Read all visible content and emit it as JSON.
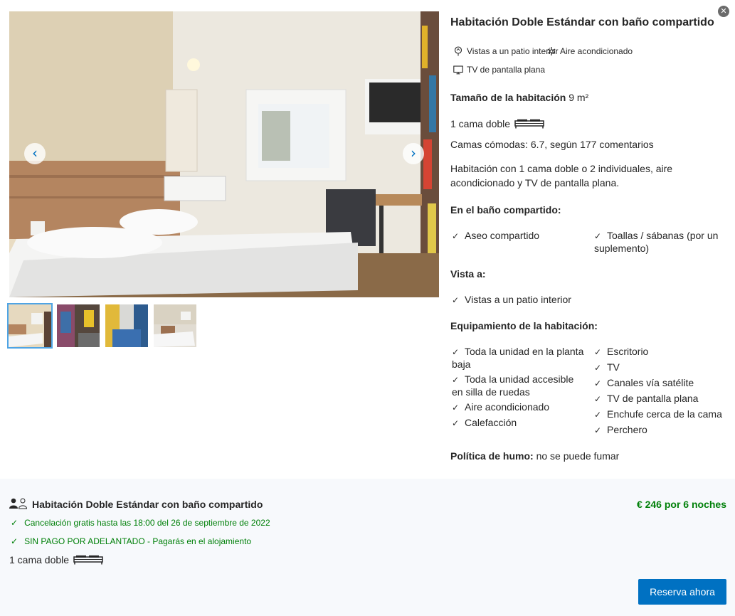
{
  "dialog": {
    "close_icon": "close-icon"
  },
  "gallery": {
    "prev_icon": "chevron-left-icon",
    "next_icon": "chevron-right-icon",
    "thumb_count": 4,
    "selected_thumb": 1
  },
  "room": {
    "title": "Habitación Doble Estándar con baño compartido",
    "facilities": [
      {
        "icon": "courtyard-icon",
        "label": "Vistas a un patio interior"
      },
      {
        "icon": "snowflake-icon",
        "label": "Aire acondicionado"
      },
      {
        "icon": "tv-icon",
        "label": "TV de pantalla plana"
      }
    ],
    "size_label": "Tamaño de la habitación",
    "size_value": "9 m²",
    "bed_text": "1 cama doble",
    "comfort": "Camas cómodas: 6.7, según 177 comentarios",
    "description": "Habitación con 1 cama doble o 2 individuales, aire acondicionado y TV de pantalla plana.",
    "bathroom_heading": "En el baño compartido:",
    "bathroom_items": [
      "Aseo compartido",
      "Toallas / sábanas (por un suplemento)"
    ],
    "view_heading": "Vista a:",
    "view_items": [
      "Vistas a un patio interior"
    ],
    "equipment_heading": "Equipamiento de la habitación:",
    "equipment_left": [
      "Toda la unidad en la planta baja",
      "Toda la unidad accesible en silla de ruedas",
      "Aire acondicionado",
      "Calefacción"
    ],
    "equipment_right": [
      "Escritorio",
      "TV",
      "Canales vía satélite",
      "TV de pantalla plana",
      "Enchufe cerca de la cama",
      "Perchero"
    ],
    "smoking_label": "Política de humo:",
    "smoking_value": "no se puede fumar"
  },
  "summary": {
    "occupancy_icon": "occupancy-icon",
    "title": "Habitación Doble Estándar con baño compartido",
    "price": "€ 246 por 6 noches",
    "cancellation": "Cancelación gratis hasta las 18:00 del 26 de septiembre de 2022",
    "prepayment": "SIN PAGO POR ADELANTADO - Pagarás en el alojamiento",
    "bed_text": "1 cama doble",
    "book_button": "Reserva ahora"
  },
  "colors": {
    "accent": "#0071c2",
    "green": "#008009",
    "summary_bg": "#f7f9fc"
  }
}
